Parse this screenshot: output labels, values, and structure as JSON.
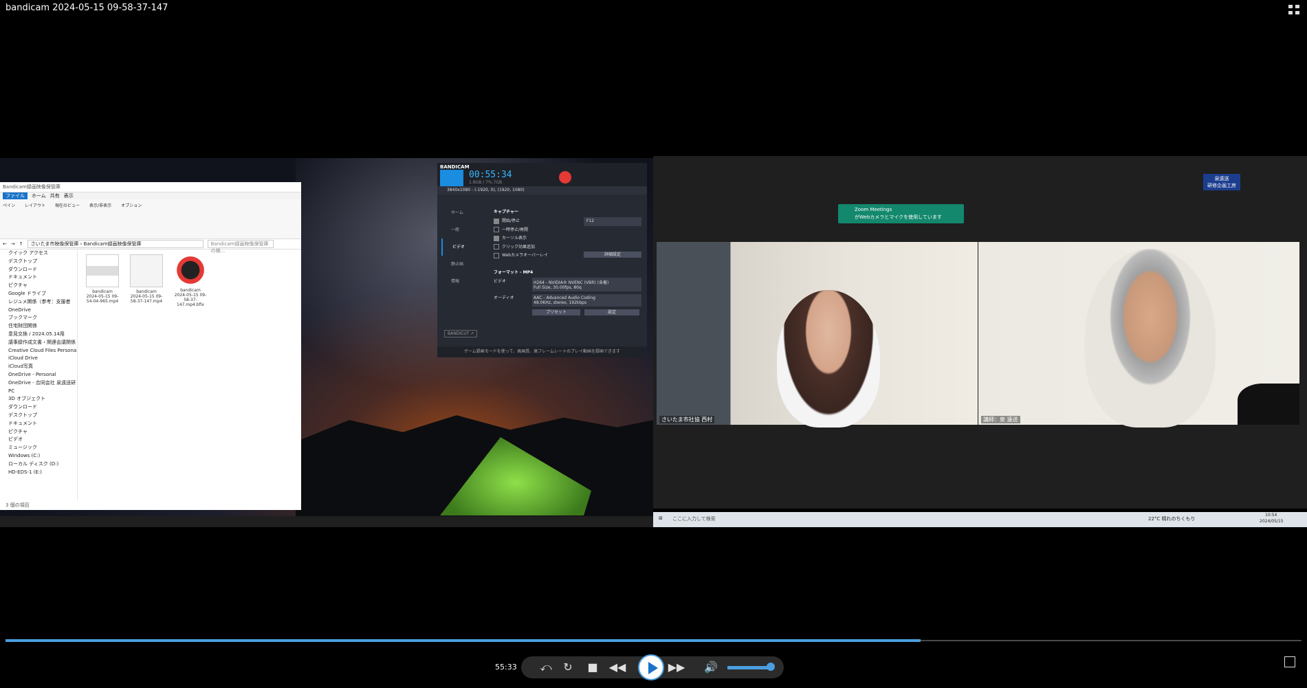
{
  "player": {
    "title": "bandicam 2024-05-15 09-58-37-147",
    "current_time": "55:33",
    "progress_fraction": 0.706,
    "volume_fraction": 0.97,
    "icons": [
      "fullscreen-exit-icon",
      "skip-back-icon",
      "replay-icon",
      "stop-icon",
      "rewind-icon",
      "play-icon",
      "fast-forward-icon",
      "volume-icon",
      "popout-icon"
    ],
    "accent_color": "#4a9ee0"
  },
  "explorer": {
    "window_title": "Bandicam録画映像保管庫",
    "ribbon_tabs": [
      "ファイル",
      "ホーム",
      "共有",
      "表示"
    ],
    "ribbon_groups": [
      "ペイン",
      "レイアウト",
      "現在のビュー",
      "表示/非表示",
      "オプション"
    ],
    "path_root": "さいたま市映像保管庫",
    "path_leaf": "Bandicam録画映像保管庫",
    "search_placeholder": "Bandicam録画映像保管庫の検...",
    "nav_items": [
      "クイック アクセス",
      "デスクトップ",
      "ダウンロード",
      "ドキュメント",
      "ピクチャ",
      "Google ドライブ",
      "レジュメ関係（参考：支援者",
      "OneDrive",
      "ブックマーク",
      "住宅財団関係",
      "意見交換 / 2024.05.14用",
      "議事録作成文書・関連会議関係",
      "Creative Cloud Files Personal Ac",
      "iCloud Drive",
      "iCloud写真",
      "OneDrive - Personal",
      "OneDrive - 合同会社 泉遠送研",
      "PC",
      "3D オブジェクト",
      "ダウンロード",
      "デスクトップ",
      "ドキュメント",
      "ピクチャ",
      "ビデオ",
      "ミュージック",
      "Windows (C:)",
      "ローカル ディスク (D:)",
      "HD-EDS-1 (E:)"
    ],
    "files": [
      {
        "name": "bandicam",
        "detail": "2024-05-15 09-54-04-965.mp4"
      },
      {
        "name": "bandicam",
        "detail": "2024-05-15 09-58-37-147.mp4"
      },
      {
        "name": "bandicam",
        "detail": "2024-05-15 09-58-37-147.mp4.bfix"
      }
    ],
    "status": "3 個の項目"
  },
  "bandicam": {
    "logo": "BANDICAM",
    "timer": "00:55:34",
    "size": "1.8GB / 7%.7GB",
    "resolution": "3840x1080 - (-1920, 0), (1920, 1080)",
    "side_items": [
      "ホーム",
      "一般",
      "ビデオ",
      "静止画",
      "情報"
    ],
    "capture_header": "キャプチャー",
    "capture_options": [
      "開始/停止",
      "一時停止/再開",
      "カーソル表示",
      "クリック効果追加",
      "Webカメラオーバーレイ"
    ],
    "hotkey": "F12",
    "detail_button": "詳細設定",
    "format_header": "フォーマット - MP4",
    "video_label": "ビデオ",
    "video_format": "H264 - NVIDIA® NVENC (VBR) (含着)",
    "video_detail": "Full Size, 30.00fps, 80q",
    "audio_label": "オーディオ",
    "audio_format": "AAC - Advanced Audio Coding",
    "audio_detail": "48.0KHz, stereo, 192kbps",
    "preset_button": "プリセット",
    "settings_button": "設定",
    "bandicut": "BANDICUT ↗",
    "footer": "ゲーム録画モードを使って、高画質、高フレームレートのプレイ動画を録画できます",
    "rec_color": "#e53935"
  },
  "zoom": {
    "toast_title": "Zoom Meetings",
    "toast_body": "がWebカメラとマイクを使用しています",
    "badge_line1": "泉遠送",
    "badge_line2": "研修企画工房",
    "participant1": "さいたま市社協 西村",
    "participant2": "講師：泉 遠送",
    "taskbar_search": "ここに入力して検索",
    "weather": "22°C 晴れのちくもり",
    "clock": "10:54",
    "date": "2024/05/15"
  }
}
